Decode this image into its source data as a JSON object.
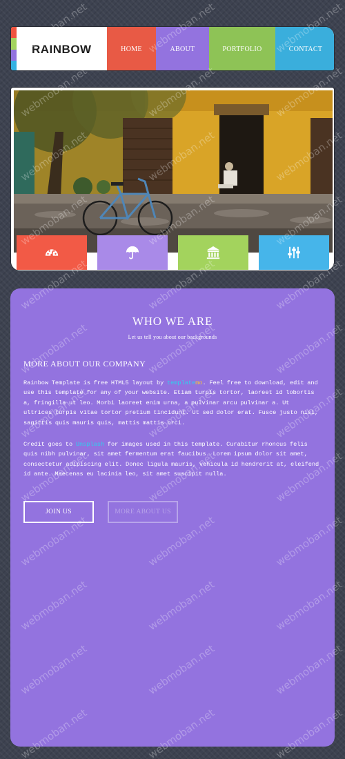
{
  "header": {
    "logo": "RAINBOW",
    "stripe_colors": [
      "#f0533e",
      "#a3d35d",
      "#9373df",
      "#34b2e3"
    ],
    "nav": [
      {
        "label": "HOME",
        "color": "#e85a45"
      },
      {
        "label": "ABOUT",
        "color": "#9373df"
      },
      {
        "label": "PORTFOLIO",
        "color": "#8ec356"
      },
      {
        "label": "CONTACT",
        "color": "#3aaedc"
      }
    ]
  },
  "hero": {
    "features": [
      {
        "icon": "dashboard-icon",
        "color": "#f25a46"
      },
      {
        "icon": "umbrella-icon",
        "color": "#a98ae8"
      },
      {
        "icon": "bank-icon",
        "color": "#a3d35d"
      },
      {
        "icon": "sliders-icon",
        "color": "#46b5ea"
      }
    ]
  },
  "about": {
    "title": "WHO WE ARE",
    "subtitle": "Let us tell you about our backgrounds",
    "heading": "MORE ABOUT OUR COMPANY",
    "p1_a": "Rainbow Template is free HTML5 layout by ",
    "p1_link1": "template",
    "p1_link2": "mo",
    "p1_b": ". Feel free to download, edit and use this template for any of your website. Etiam turpis tortor, laoreet id lobortis a, fringilla ut leo. Morbi laoreet enim urna, a pulvinar arcu pulvinar a. Ut ultrices turpis vitae tortor pretium tincidunt. Ut sed dolor erat. Fusce justo nisi, sagittis quis mauris quis, mattis mattis orci.",
    "p2_a": "Credit goes to ",
    "p2_link": "Unsplash",
    "p2_b": " for images used in this template. Curabitur rhoncus felis quis nibh pulvinar, sit amet fermentum erat faucibus. Lorem ipsum dolor sit amet, consectetur adipiscing elit. Donec ligula mauris, vehicula id hendrerit at, eleifend id ante. Maecenas eu lacinia leo, sit amet suscipit nulla.",
    "btn_join": "JOIN US",
    "btn_more": "MORE ABOUT US"
  },
  "watermark": "webmoban.net"
}
